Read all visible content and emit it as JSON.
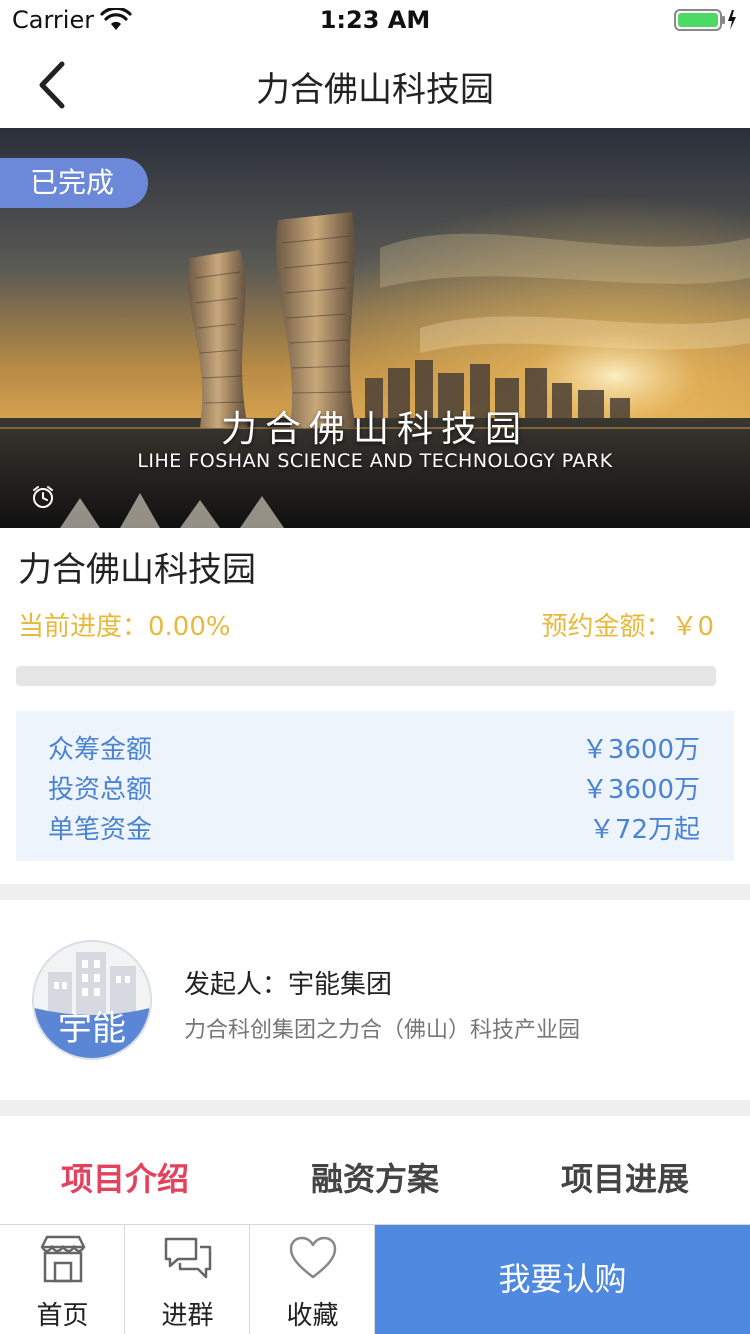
{
  "status_bar": {
    "carrier": "Carrier",
    "time": "1:23 AM"
  },
  "nav": {
    "title": "力合佛山科技园"
  },
  "hero": {
    "badge": "已完成",
    "overlay_title": "力合佛山科技园",
    "overlay_subtitle": "LIHE FOSHAN SCIENCE AND TECHNOLOGY PARK"
  },
  "project": {
    "name": "力合佛山科技园",
    "progress_label": "当前进度：0.00%",
    "progress_value": 0,
    "reserve_label": "预约金额：￥0"
  },
  "stats": [
    {
      "label": "众筹金额",
      "value": "￥3600万"
    },
    {
      "label": "投资总额",
      "value": "￥3600万"
    },
    {
      "label": "单笔资金",
      "value": "￥72万起"
    }
  ],
  "sponsor": {
    "avatar_text": "宇能",
    "name": "发起人：宇能集团",
    "description": "力合科创集团之力合（佛山）科技产业园"
  },
  "tabs": [
    {
      "label": "项目介绍",
      "active": true
    },
    {
      "label": "融资方案",
      "active": false
    },
    {
      "label": "项目进展",
      "active": false
    }
  ],
  "bottom_bar": {
    "items": [
      {
        "label": "首页",
        "icon": "store-icon"
      },
      {
        "label": "进群",
        "icon": "chat-icon"
      },
      {
        "label": "收藏",
        "icon": "heart-icon"
      }
    ],
    "buy_label": "我要认购"
  },
  "colors": {
    "badge": "#6b89d8",
    "accent_gold": "#e8b93c",
    "stats_text": "#4a82d4",
    "stats_bg": "#eef4fc",
    "active_tab": "#e4425c",
    "buy_button": "#4f89e0"
  }
}
